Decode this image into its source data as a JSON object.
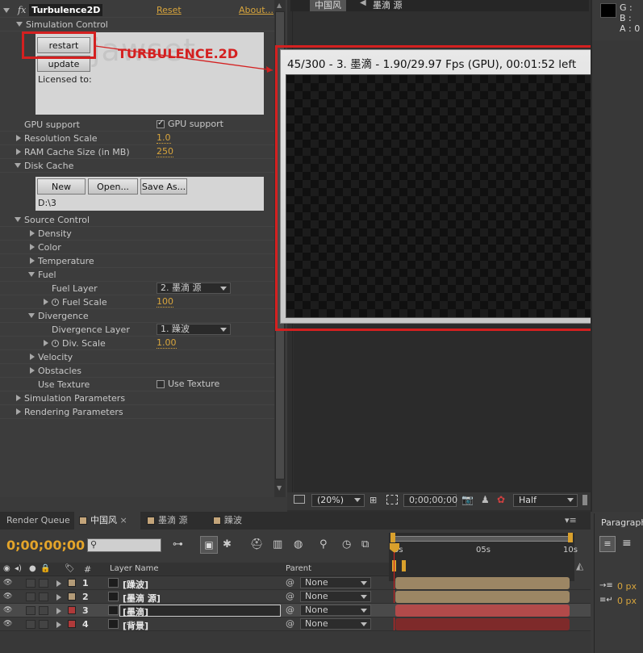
{
  "effect_panel": {
    "effect_name": "Turbulence2D",
    "reset_label": "Reset",
    "about_label": "About...",
    "simulation_control": "Simulation Control",
    "restart_label": "restart",
    "update_label": "update",
    "licensed_to": "Licensed to:",
    "watermark_text": "jawset",
    "gpu_support_label": "GPU support",
    "gpu_support_checkbox": "GPU support",
    "resolution_scale_label": "Resolution Scale",
    "resolution_scale_value": "1.0",
    "ram_cache_label": "RAM Cache Size (in MB)",
    "ram_cache_value": "250",
    "disk_cache_label": "Disk Cache",
    "new_label": "New",
    "open_label": "Open...",
    "save_as_label": "Save As...",
    "disk_path": "D:\\3",
    "source_control_label": "Source Control",
    "density_label": "Density",
    "color_label": "Color",
    "temperature_label": "Temperature",
    "fuel_label": "Fuel",
    "fuel_layer_label": "Fuel Layer",
    "fuel_layer_value": "2. 墨滴 源",
    "fuel_scale_label": "Fuel Scale",
    "fuel_scale_value": "100",
    "divergence_label": "Divergence",
    "divergence_layer_label": "Divergence Layer",
    "divergence_layer_value": "1. 躁波",
    "div_scale_label": "Div. Scale",
    "div_scale_value": "1.00",
    "velocity_label": "Velocity",
    "obstacles_label": "Obstacles",
    "use_texture_label": "Use Texture",
    "use_texture_checkbox": "Use Texture",
    "simulation_parameters_label": "Simulation Parameters",
    "rendering_parameters_label": "Rendering Parameters"
  },
  "annotation": {
    "title": "TURBULENCE.2D",
    "color": "#d42020"
  },
  "viewer": {
    "tab_label": "中国风",
    "tab_label2": "墨滴 源",
    "status_text": "45/300 - 3. 墨滴 - 1.90/29.97 Fps (GPU), 00:01:52 left",
    "zoom": "(20%)",
    "timecode": "0;00;00;00",
    "resolution": "Half"
  },
  "info_panel": {
    "g_label": "G :",
    "b_label": "B :",
    "a_label": "A : 0"
  },
  "paragraph_panel": {
    "tab_label": "Paragraph",
    "indent1": "0 px",
    "indent2": "0 px"
  },
  "timeline": {
    "tabs": [
      {
        "label": "Render Queue"
      },
      {
        "label": "中国风"
      },
      {
        "label": "墨滴 源"
      },
      {
        "label": "躁波"
      }
    ],
    "timecode": "0;00;00;00",
    "search_placeholder": "",
    "col_hash": "#",
    "col_layer_name": "Layer Name",
    "col_parent": "Parent",
    "ruler": [
      "0s",
      "05s",
      "10s"
    ],
    "layers": [
      {
        "num": "1",
        "name": "[躁波]",
        "parent": "None",
        "label_color": "#b39b78",
        "bar_color": "#9c8664"
      },
      {
        "num": "2",
        "name": "[墨滴 源]",
        "parent": "None",
        "label_color": "#b39b78",
        "bar_color": "#9c8664"
      },
      {
        "num": "3",
        "name": "[墨滴]",
        "parent": "None",
        "label_color": "#b03a3a",
        "bar_color": "#b24a4a"
      },
      {
        "num": "4",
        "name": "[背景]",
        "parent": "None",
        "label_color": "#b03a3a",
        "bar_color": "#7e2a2a"
      }
    ]
  }
}
